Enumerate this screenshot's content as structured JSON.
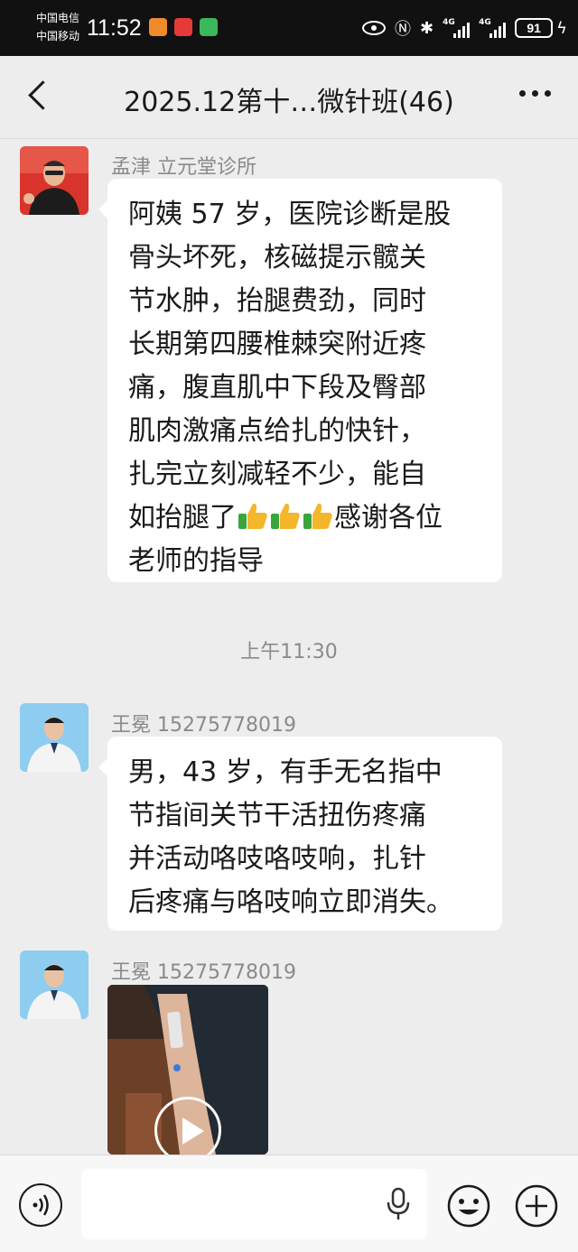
{
  "status_bar": {
    "carrier_1": "中国电信",
    "carrier_2": "中国移动",
    "time": "11:52",
    "network_1": "4G",
    "network_2": "4G",
    "battery": "91"
  },
  "header": {
    "title": "2025.12第十…微针班(46)",
    "back_icon": "chevron-left-icon",
    "more_icon": "more-dots-icon"
  },
  "messages": [
    {
      "sender": "孟津   立元堂诊所",
      "lines": [
        "阿姨 57 岁，医院诊断是股",
        "骨头坏死，核磁提示髋关",
        "节水肿，抬腿费劲，同时",
        "长期第四腰椎棘突附近疼",
        "痛，腹直肌中下段及臀部",
        "肌肉激痛点给扎的快针，",
        "扎完立刻减轻不少，能自"
      ],
      "line_8_before": "如抬腿了",
      "line_8_after": "感谢各位",
      "line_9": "老师的指导",
      "emoji": "thumbs-up-icon"
    },
    {
      "sender": "王冕  15275778019",
      "lines": [
        "男，43 岁，有手无名指中",
        "节指间关节干活扭伤疼痛",
        "并活动咯吱咯吱响，扎针",
        "后疼痛与咯吱响立即消失。"
      ]
    },
    {
      "sender": "王冕  15275778019",
      "video_icon": "play-icon"
    }
  ],
  "timestamp": "上午11:30",
  "input_bar": {
    "voice_icon": "voice-icon",
    "mic_icon": "microphone-icon",
    "emoji_icon": "emoji-icon",
    "plus_icon": "plus-icon"
  },
  "colors": {
    "background": "#ededed",
    "bubble": "#ffffff",
    "status_bar": "#111111",
    "muted_text": "#8a8a8a"
  }
}
